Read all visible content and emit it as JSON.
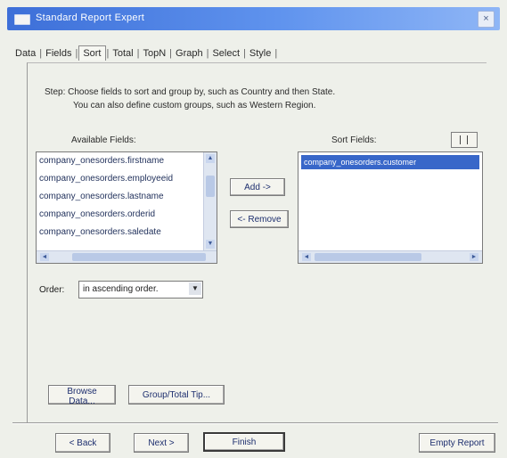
{
  "window": {
    "title": "Standard Report Expert",
    "close_symbol": "×"
  },
  "tabs": [
    {
      "label": "Data"
    },
    {
      "label": "Fields"
    },
    {
      "label": "Sort",
      "active": true
    },
    {
      "label": "Total"
    },
    {
      "label": "TopN"
    },
    {
      "label": "Graph"
    },
    {
      "label": "Select"
    },
    {
      "label": "Style"
    }
  ],
  "instructions": {
    "line1": "Step: Choose fields to sort and group by, such as Country and then State.",
    "line2": "You can also define custom groups, such as Western Region."
  },
  "available_fields": {
    "label": "Available Fields:",
    "items": [
      "company_onesorders.firstname",
      "company_onesorders.employeeid",
      "company_onesorders.lastname",
      "company_onesorders.orderid",
      "company_onesorders.saledate"
    ]
  },
  "sort_fields": {
    "label": "Sort Fields:",
    "items": [
      "company_onesorders.customer"
    ]
  },
  "buttons": {
    "add": "Add ->",
    "remove": "<- Remove",
    "browse_data": "Browse Data...",
    "group_total_tip": "Group/Total Tip...",
    "back": "< Back",
    "next": "Next >",
    "finish": "Finish",
    "empty_report": "Empty Report"
  },
  "order": {
    "label": "Order:",
    "value": "in ascending order."
  },
  "scroll_glyphs": {
    "up": "▲",
    "down": "▼",
    "left": "◄",
    "right": "►",
    "combo_drop": "▼"
  }
}
